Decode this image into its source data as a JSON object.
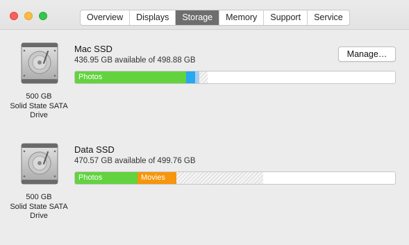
{
  "window": {
    "tabs": [
      {
        "label": "Overview"
      },
      {
        "label": "Displays"
      },
      {
        "label": "Storage",
        "active": true
      },
      {
        "label": "Memory"
      },
      {
        "label": "Support"
      },
      {
        "label": "Service"
      }
    ]
  },
  "disks": [
    {
      "icon": "hard-drive-icon",
      "caption_line1": "500 GB",
      "caption_line2": "Solid State SATA",
      "caption_line3": "Drive",
      "name": "Mac SSD",
      "available_text": "436.95 GB available of 498.88 GB",
      "manage_label": "Manage…",
      "segments": [
        {
          "label": "Photos",
          "fraction": 0.348,
          "color": "#62d33f"
        },
        {
          "label": "",
          "fraction": 0.029,
          "color": "#27a8f0"
        },
        {
          "label": "",
          "fraction": 0.013,
          "color": "#a9cdee"
        },
        {
          "label": "",
          "fraction": 0.026,
          "color": "hatched"
        }
      ]
    },
    {
      "icon": "hard-drive-icon",
      "caption_line1": "500 GB",
      "caption_line2": "Solid State SATA",
      "caption_line3": "Drive",
      "name": "Data SSD",
      "available_text": "470.57 GB available of 499.76 GB",
      "segments": [
        {
          "label": "Photos",
          "fraction": 0.196,
          "color": "#62d33f"
        },
        {
          "label": "Movies",
          "fraction": 0.121,
          "color": "#f7950c"
        },
        {
          "label": "",
          "fraction": 0.272,
          "color": "hatched"
        }
      ]
    }
  ],
  "colors": {
    "photos": "#62d33f",
    "movies": "#f7950c",
    "apps": "#27a8f0",
    "other": "#a9cdee",
    "tab_active": "#6e6e6e"
  }
}
